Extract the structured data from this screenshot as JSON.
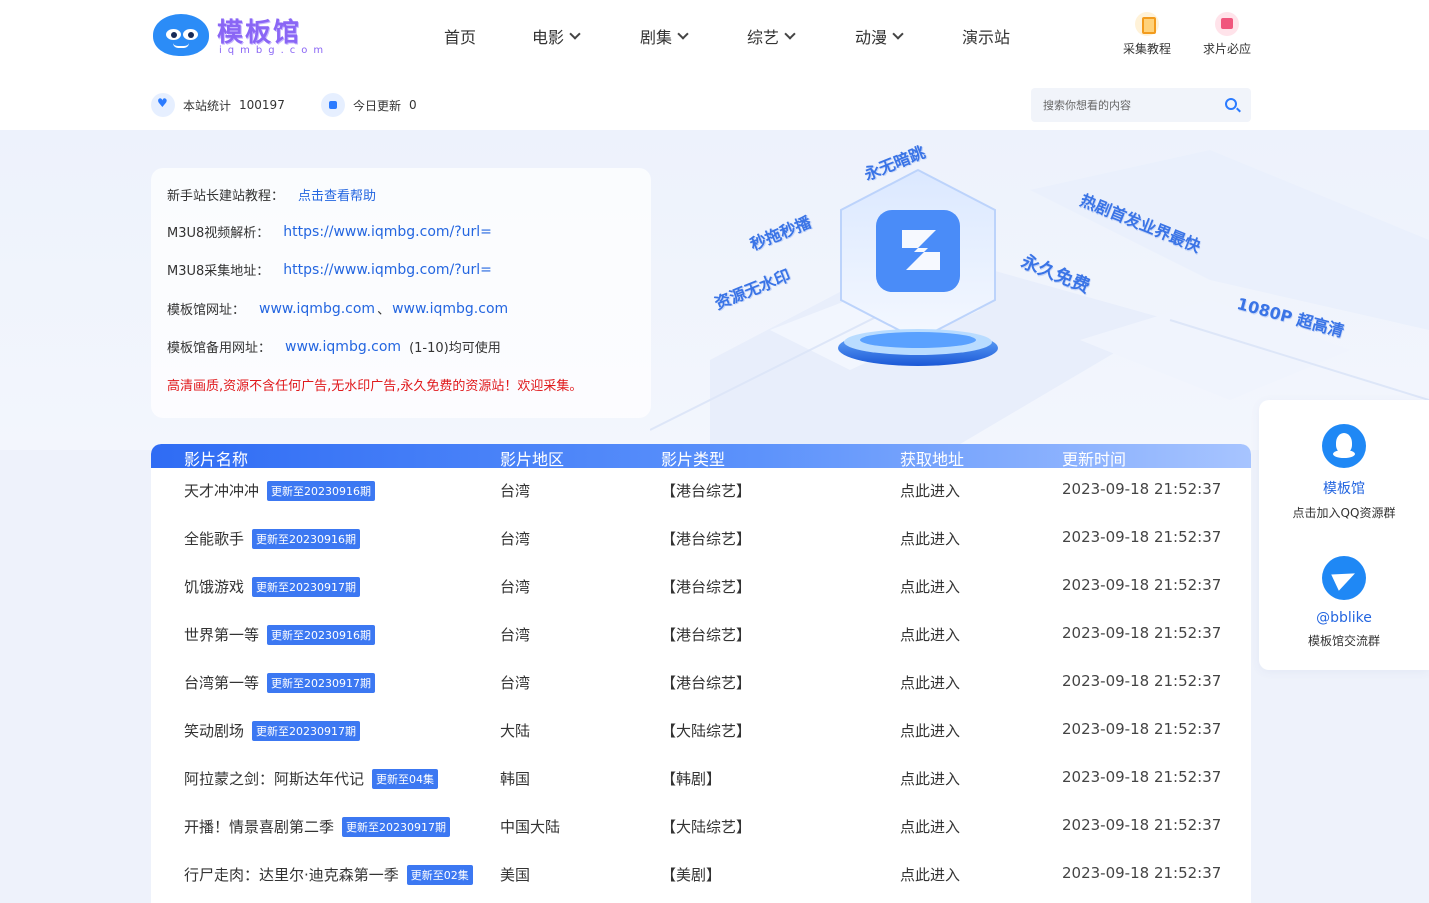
{
  "logo": {
    "title": "模板馆",
    "subtitle": "iqmbg.com"
  },
  "nav": [
    {
      "label": "首页",
      "dropdown": false
    },
    {
      "label": "电影",
      "dropdown": true
    },
    {
      "label": "剧集",
      "dropdown": true
    },
    {
      "label": "综艺",
      "dropdown": true
    },
    {
      "label": "动漫",
      "dropdown": true
    },
    {
      "label": "演示站",
      "dropdown": false
    }
  ],
  "quick_links": [
    {
      "label": "采集教程",
      "icon": "document-icon"
    },
    {
      "label": "求片必应",
      "icon": "film-request-icon"
    }
  ],
  "stats": [
    {
      "label": "本站统计",
      "value": "100197",
      "icon": "heart-icon"
    },
    {
      "label": "今日更新",
      "value": "0",
      "icon": "calendar-icon"
    }
  ],
  "search": {
    "placeholder": "搜索你想看的内容"
  },
  "info": {
    "tutorial_label": "新手站长建站教程：",
    "tutorial_link": "点击查看帮助",
    "m3u8_parse_label": "M3U8视频解析：",
    "m3u8_parse_url": "https://www.iqmbg.com/?url=",
    "m3u8_collect_label": "M3U8采集地址：",
    "m3u8_collect_url": "https://www.iqmbg.com/?url=",
    "site_label": "模板馆网址：",
    "site_url_1": "www.iqmbg.com",
    "site_sep": "、",
    "site_url_2": "www.iqmbg.com",
    "backup_label": "模板馆备用网址：",
    "backup_url": "www.iqmbg.com",
    "backup_note": "(1-10)均可使用",
    "notice": "高清画质,资源不含任何广告,无水印广告,永久免费的资源站！欢迎采集。"
  },
  "hero_slogans": [
    "永无暗跳",
    "秒拖秒播",
    "资源无水印",
    "热剧首发业界最快",
    "永久免费",
    "1080P 超高清"
  ],
  "table": {
    "headers": [
      "影片名称",
      "影片地区",
      "影片类型",
      "获取地址",
      "更新时间"
    ],
    "rows": [
      {
        "name": "天才冲冲冲",
        "badge": "更新至20230916期",
        "region": "台湾",
        "type": "【港台综艺】",
        "link": "点此进入",
        "time": "2023-09-18 21:52:37"
      },
      {
        "name": "全能歌手",
        "badge": "更新至20230916期",
        "region": "台湾",
        "type": "【港台综艺】",
        "link": "点此进入",
        "time": "2023-09-18 21:52:37"
      },
      {
        "name": "饥饿游戏",
        "badge": "更新至20230917期",
        "region": "台湾",
        "type": "【港台综艺】",
        "link": "点此进入",
        "time": "2023-09-18 21:52:37"
      },
      {
        "name": "世界第一等",
        "badge": "更新至20230916期",
        "region": "台湾",
        "type": "【港台综艺】",
        "link": "点此进入",
        "time": "2023-09-18 21:52:37"
      },
      {
        "name": "台湾第一等",
        "badge": "更新至20230917期",
        "region": "台湾",
        "type": "【港台综艺】",
        "link": "点此进入",
        "time": "2023-09-18 21:52:37"
      },
      {
        "name": "笑动剧场",
        "badge": "更新至20230917期",
        "region": "大陆",
        "type": "【大陆综艺】",
        "link": "点此进入",
        "time": "2023-09-18 21:52:37"
      },
      {
        "name": "阿拉蒙之剑：阿斯达年代记",
        "badge": "更新至04集",
        "region": "韩国",
        "type": "【韩剧】",
        "link": "点此进入",
        "time": "2023-09-18 21:52:37"
      },
      {
        "name": "开播！情景喜剧第二季",
        "badge": "更新至20230917期",
        "region": "中国大陆",
        "type": "【大陆综艺】",
        "link": "点此进入",
        "time": "2023-09-18 21:52:37"
      },
      {
        "name": "行尸走肉：达里尔·迪克森第一季",
        "badge": "更新至02集",
        "region": "美国",
        "type": "【美剧】",
        "link": "点此进入",
        "time": "2023-09-18 21:52:37"
      }
    ]
  },
  "side": [
    {
      "name": "模板馆",
      "desc": "点击加入QQ资源群",
      "icon": "qq-icon"
    },
    {
      "name": "@bblike",
      "desc": "模板馆交流群",
      "icon": "telegram-icon"
    }
  ],
  "colors": {
    "accent": "#2466e0",
    "brand_purple": "#8a66f5",
    "notice_red": "#e0191c",
    "badge_blue": "#3c78f2"
  }
}
